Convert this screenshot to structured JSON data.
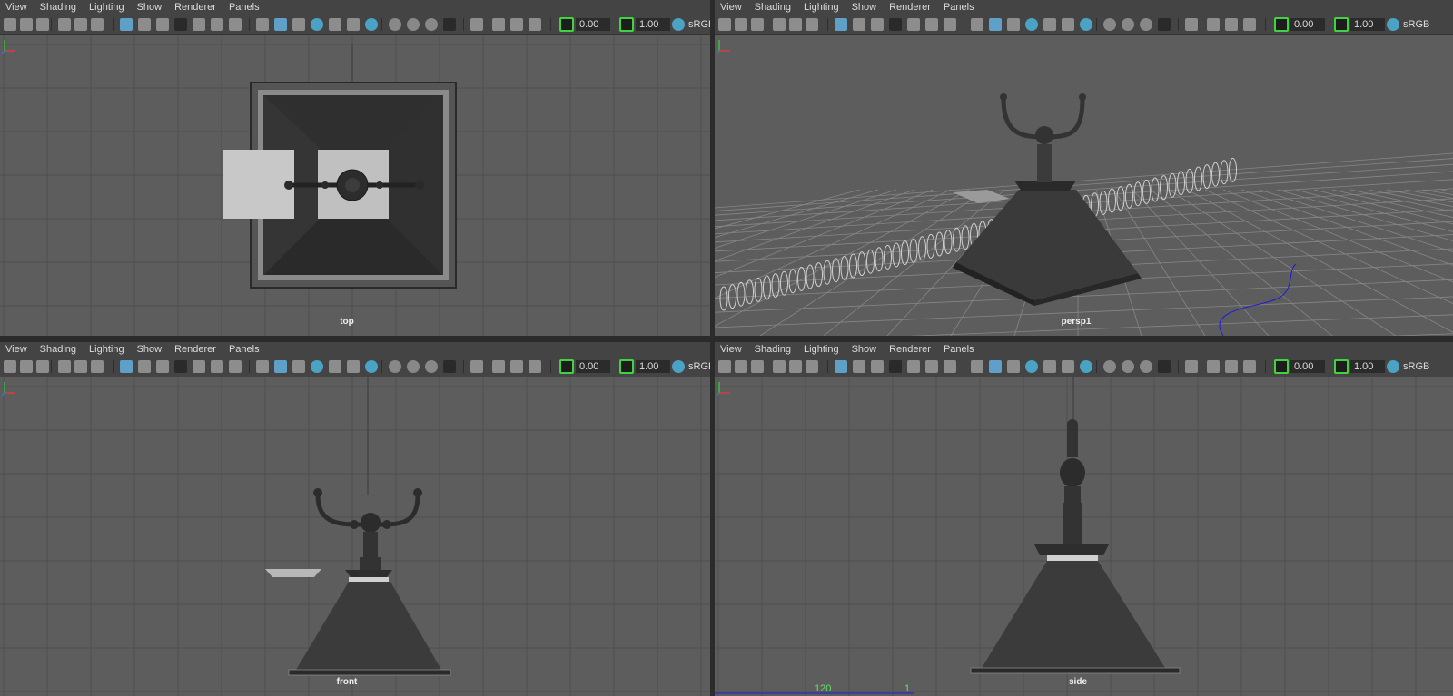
{
  "menu": [
    "View",
    "Shading",
    "Lighting",
    "Show",
    "Renderer",
    "Panels"
  ],
  "toolbar": {
    "value1": "0.00",
    "value2": "1.00",
    "colorspace": "sRGB"
  },
  "panels": [
    {
      "id": "top",
      "label": "top"
    },
    {
      "id": "persp",
      "label": "persp1"
    },
    {
      "id": "front",
      "label": "front"
    },
    {
      "id": "side",
      "label": "side"
    }
  ],
  "timeline": {
    "frame_a": "120",
    "frame_b": "1"
  },
  "colors": {
    "viewport": "#5d5d5d",
    "grid": "#4e4e4e",
    "selected": "#5ea0c8",
    "accent_green": "#3fd43f"
  },
  "icons": [
    "camera-icon",
    "bookmark-icon",
    "grid-icon",
    "wireframe-icon",
    "shaded-icon",
    "light-icon",
    "isolate-icon",
    "exposure-icon",
    "gamma-icon"
  ]
}
